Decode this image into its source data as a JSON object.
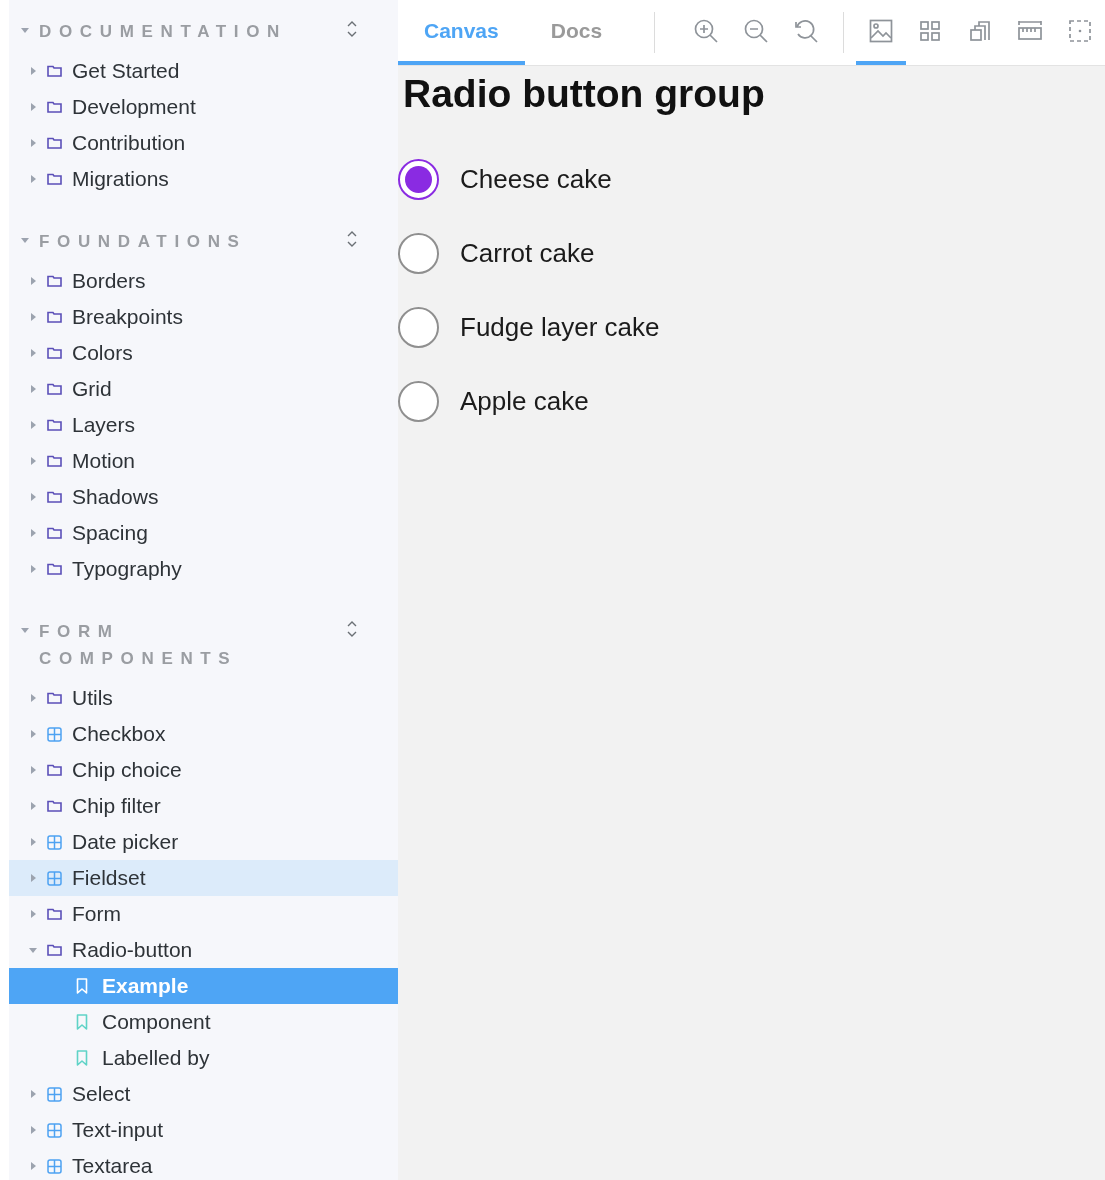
{
  "sidebar": {
    "sections": [
      {
        "title": "DOCUMENTATION",
        "expanded": true,
        "items": [
          {
            "label": "Get Started",
            "kind": "folder",
            "expanded": false
          },
          {
            "label": "Development",
            "kind": "folder",
            "expanded": false
          },
          {
            "label": "Contribution",
            "kind": "folder",
            "expanded": false
          },
          {
            "label": "Migrations",
            "kind": "folder",
            "expanded": false
          }
        ]
      },
      {
        "title": "FOUNDATIONS",
        "expanded": true,
        "items": [
          {
            "label": "Borders",
            "kind": "folder",
            "expanded": false
          },
          {
            "label": "Breakpoints",
            "kind": "folder",
            "expanded": false
          },
          {
            "label": "Colors",
            "kind": "folder",
            "expanded": false
          },
          {
            "label": "Grid",
            "kind": "folder",
            "expanded": false
          },
          {
            "label": "Layers",
            "kind": "folder",
            "expanded": false
          },
          {
            "label": "Motion",
            "kind": "folder",
            "expanded": false
          },
          {
            "label": "Shadows",
            "kind": "folder",
            "expanded": false
          },
          {
            "label": "Spacing",
            "kind": "folder",
            "expanded": false
          },
          {
            "label": "Typography",
            "kind": "folder",
            "expanded": false
          }
        ]
      },
      {
        "title": "FORM COMPONENTS",
        "expanded": true,
        "items": [
          {
            "label": "Utils",
            "kind": "folder",
            "expanded": false
          },
          {
            "label": "Checkbox",
            "kind": "component",
            "expanded": false
          },
          {
            "label": "Chip choice",
            "kind": "folder",
            "expanded": false
          },
          {
            "label": "Chip filter",
            "kind": "folder",
            "expanded": false
          },
          {
            "label": "Date picker",
            "kind": "component",
            "expanded": false
          },
          {
            "label": "Fieldset",
            "kind": "component",
            "expanded": false,
            "highlighted": true
          },
          {
            "label": "Form",
            "kind": "folder",
            "expanded": false
          },
          {
            "label": "Radio-button",
            "kind": "folder",
            "expanded": true,
            "children": [
              {
                "label": "Example",
                "kind": "story",
                "selected": true
              },
              {
                "label": "Component",
                "kind": "story",
                "selected": false
              },
              {
                "label": "Labelled by",
                "kind": "story",
                "selected": false
              }
            ]
          },
          {
            "label": "Select",
            "kind": "component",
            "expanded": false
          },
          {
            "label": "Text-input",
            "kind": "component",
            "expanded": false
          },
          {
            "label": "Textarea",
            "kind": "component",
            "expanded": false
          }
        ]
      }
    ]
  },
  "toolbar": {
    "tabs": [
      {
        "label": "Canvas",
        "selected": true
      },
      {
        "label": "Docs",
        "selected": false
      }
    ],
    "tools": [
      {
        "kind": "zoom-in",
        "selected": false
      },
      {
        "kind": "zoom-out",
        "selected": false
      },
      {
        "kind": "reset",
        "selected": false
      },
      {
        "kind": "divider"
      },
      {
        "kind": "image",
        "selected": true
      },
      {
        "kind": "grid",
        "selected": false
      },
      {
        "kind": "outline",
        "selected": false
      },
      {
        "kind": "ruler",
        "selected": false
      },
      {
        "kind": "viewport",
        "selected": false
      }
    ]
  },
  "canvas": {
    "heading": "Radio button group",
    "options": [
      {
        "label": "Cheese cake",
        "selected": true
      },
      {
        "label": "Carrot cake",
        "selected": false
      },
      {
        "label": "Fudge layer cake",
        "selected": false
      },
      {
        "label": "Apple cake",
        "selected": false
      }
    ]
  }
}
